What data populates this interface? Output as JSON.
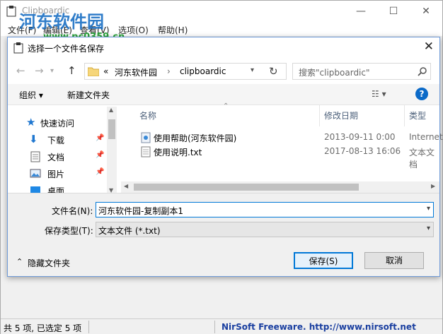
{
  "parent": {
    "title": "Clipboardic",
    "menu": [
      "文件(F)",
      "编辑(E)",
      "查看(V)",
      "选项(O)",
      "帮助(H)"
    ],
    "watermark": "河东软件园",
    "watermark_url": "www.pc0359.cn",
    "status_left": "共 5 项, 已选定 5 项",
    "status_right": "NirSoft Freeware.  http://www.nirsoft.net"
  },
  "dialog": {
    "title": "选择一个文件名保存",
    "close_glyph": "✕",
    "breadcrumb": [
      "«",
      "河东软件园",
      "›",
      "clipboardic"
    ],
    "search_placeholder": "搜索\"clipboardic\"",
    "toolbar": {
      "organize": "组织 ▾",
      "new_folder": "新建文件夹",
      "help": "?"
    },
    "tree": [
      {
        "label": "快速访问",
        "icon": "star-icon"
      },
      {
        "label": "下载",
        "icon": "download-icon"
      },
      {
        "label": "文档",
        "icon": "document-icon"
      },
      {
        "label": "图片",
        "icon": "picture-icon"
      },
      {
        "label": "桌面",
        "icon": "desktop-icon"
      }
    ],
    "columns": [
      "名称",
      "修改日期",
      "类型"
    ],
    "files": [
      {
        "name": "使用帮助(河东软件园)",
        "date": "2013-09-11 0:00",
        "type": "Internet"
      },
      {
        "name": "使用说明.txt",
        "date": "2017-08-13 16:06",
        "type": "文本文档"
      }
    ],
    "filename_label": "文件名(N):",
    "filename_value": "河东软件园-复制副本1",
    "filetype_label": "保存类型(T):",
    "filetype_value": "文本文件 (*.txt)",
    "hide_folders": "隐藏文件夹",
    "save_button": "保存(S)",
    "cancel_button": "取消"
  },
  "colors": {
    "accent": "#0078d7",
    "status_link": "#1a3fa0"
  }
}
